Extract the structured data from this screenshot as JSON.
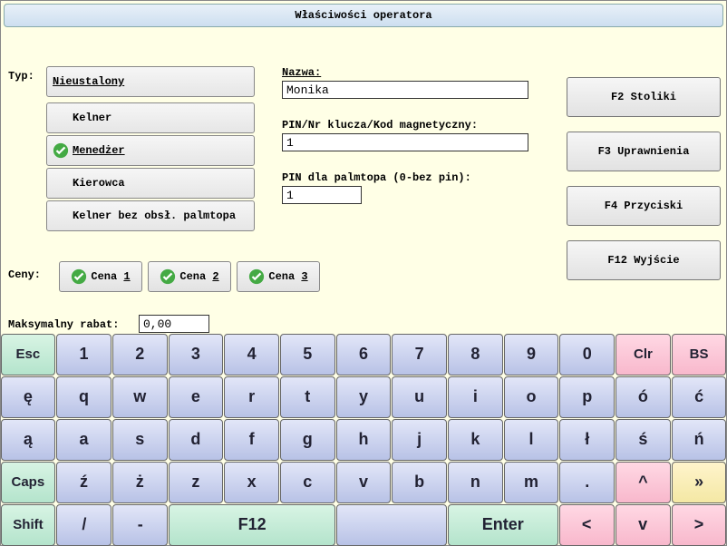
{
  "title": "Właściwości operatora",
  "labels": {
    "typ": "Typ:",
    "nazwa": "Nazwa:",
    "pin": "PIN/Nr klucza/Kod magnetyczny:",
    "pin_palm": "PIN dla palmtopa (0-bez pin):",
    "ceny": "Ceny:",
    "max_rabat": "Maksymalny rabat:"
  },
  "types": {
    "nieustalony": "Nieustalony",
    "kelner": "Kelner",
    "menedzer": "Menedżer",
    "kierowca": "Kierowca",
    "kelner_bez": "Kelner bez obsł. palmtopa"
  },
  "inputs": {
    "nazwa": "Monika",
    "pin": "1",
    "pin_palm": "1",
    "max_rabat": "0,00"
  },
  "side": {
    "f2": "F2 Stoliki",
    "f3": "F3 Uprawnienia",
    "f4": "F4 Przyciski",
    "f12": "F12 Wyjście"
  },
  "prices": {
    "p1a": "Cena ",
    "p1b": "1",
    "p2a": "Cena ",
    "p2b": "2",
    "p3a": "Cena ",
    "p3b": "3"
  },
  "kb": {
    "r1": {
      "esc": "Esc",
      "k1": "1",
      "k2": "2",
      "k3": "3",
      "k4": "4",
      "k5": "5",
      "k6": "6",
      "k7": "7",
      "k8": "8",
      "k9": "9",
      "k0": "0",
      "clr": "Clr",
      "bs": "BS"
    },
    "r2": {
      "k0": "ę",
      "k1": "q",
      "k2": "w",
      "k3": "e",
      "k4": "r",
      "k5": "t",
      "k6": "y",
      "k7": "u",
      "k8": "i",
      "k9": "o",
      "k10": "p",
      "k11": "ó",
      "k12": "ć"
    },
    "r3": {
      "k0": "ą",
      "k1": "a",
      "k2": "s",
      "k3": "d",
      "k4": "f",
      "k5": "g",
      "k6": "h",
      "k7": "j",
      "k8": "k",
      "k9": "l",
      "k10": "ł",
      "k11": "ś",
      "k12": "ń"
    },
    "r4": {
      "caps": "Caps",
      "k1": "ź",
      "k2": "ż",
      "k3": "z",
      "k4": "x",
      "k5": "c",
      "k6": "v",
      "k7": "b",
      "k8": "n",
      "k9": "m",
      "k10": ".",
      "up": "^",
      "raquo": "»"
    },
    "r5": {
      "shift": "Shift",
      "k1": "/",
      "k2": "-",
      "f12": "F12",
      "space": "",
      "enter": "Enter",
      "left": "<",
      "down": "v",
      "right": ">"
    }
  }
}
